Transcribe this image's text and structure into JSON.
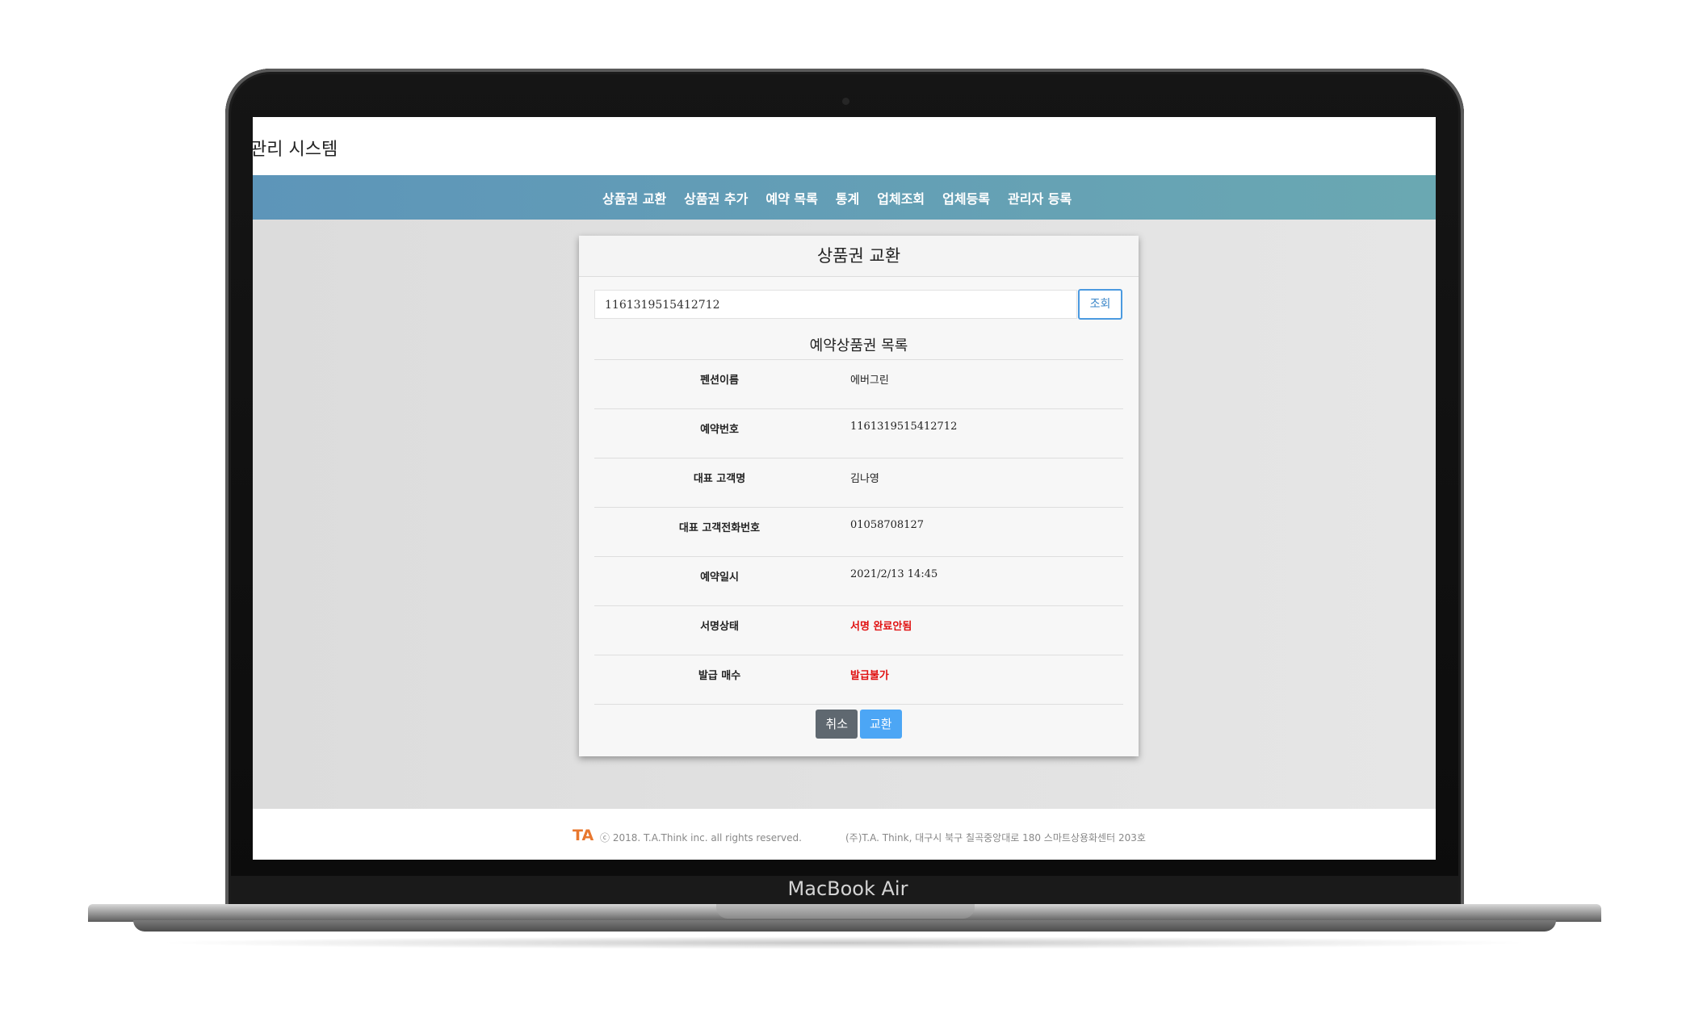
{
  "laptop": {
    "brand": "MacBook Air"
  },
  "header": {
    "title": "관리 시스템"
  },
  "nav": {
    "items": [
      "상품권 교환",
      "상품권 추가",
      "예약 목록",
      "통계",
      "업체조회",
      "업체등록",
      "관리자 등록"
    ]
  },
  "card": {
    "title": "상품권 교환",
    "search": {
      "value": "1161319515412712",
      "button_label": "조회"
    },
    "list_title": "예약상품권 목록",
    "rows": [
      {
        "label": "펜션이름",
        "value": "에버그린"
      },
      {
        "label": "예약번호",
        "value": "1161319515412712"
      },
      {
        "label": "대표 고객명",
        "value": "김나영"
      },
      {
        "label": "대표 고객전화번호",
        "value": "01058708127"
      },
      {
        "label": "예약일시",
        "value": "2021/2/13 14:45"
      },
      {
        "label": "서명상태",
        "value": "서명 완료안됨",
        "status": "alert"
      },
      {
        "label": "발급 매수",
        "value": "발급불가",
        "status": "alert"
      }
    ],
    "buttons": {
      "cancel": "취소",
      "exchange": "교환"
    }
  },
  "footer": {
    "logo": "TA",
    "copyright": "ⓒ 2018. T.A.Think inc. all rights reserved.",
    "address": "(주)T.A. Think, 대구시 북구 칠곡중앙대로 180 스마트상용화센터 203호"
  },
  "colors": {
    "nav_gradient_start": "#5d95b9",
    "nav_gradient_end": "#6aa8b2",
    "alert": "#e01010",
    "primary_button": "#4ca6f5",
    "cancel_button": "#5f6870",
    "logo": "#e8772e"
  }
}
